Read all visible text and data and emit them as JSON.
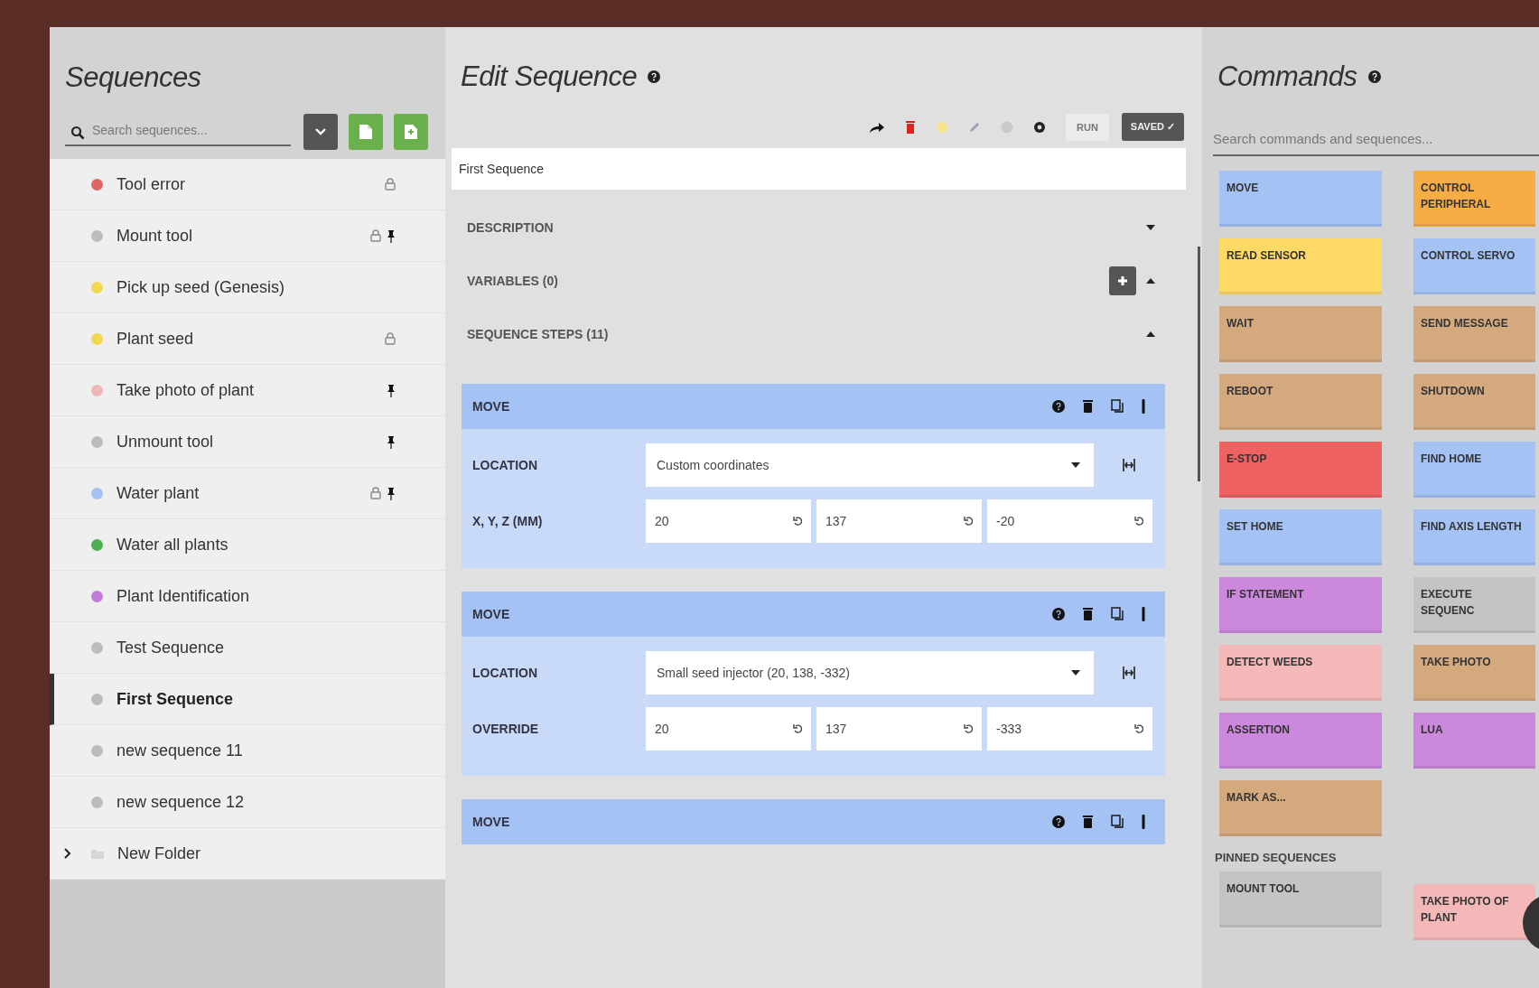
{
  "sequences_panel": {
    "title": "Sequences",
    "search": {
      "placeholder": "Search sequences..."
    },
    "items": [
      {
        "kind": "sequence",
        "name": "Tool error",
        "color": "#e06666",
        "selected": false,
        "locked": true,
        "pinned": false
      },
      {
        "kind": "sequence",
        "name": "Mount tool",
        "color": "#bcbcbc",
        "selected": false,
        "locked": true,
        "pinned": true
      },
      {
        "kind": "sequence",
        "name": "Pick up seed (Genesis)",
        "color": "#f1d84f",
        "selected": false,
        "locked": false,
        "pinned": false
      },
      {
        "kind": "sequence",
        "name": "Plant seed",
        "color": "#f1d84f",
        "selected": false,
        "locked": true,
        "pinned": false
      },
      {
        "kind": "sequence",
        "name": "Take photo of plant",
        "color": "#eeb8b8",
        "selected": false,
        "locked": false,
        "pinned": true
      },
      {
        "kind": "sequence",
        "name": "Unmount tool",
        "color": "#bcbcbc",
        "selected": false,
        "locked": false,
        "pinned": true
      },
      {
        "kind": "sequence",
        "name": "Water plant",
        "color": "#a4c2f4",
        "selected": false,
        "locked": true,
        "pinned": true
      },
      {
        "kind": "sequence",
        "name": "Water all plants",
        "color": "#4caf50",
        "selected": false,
        "locked": false,
        "pinned": false
      },
      {
        "kind": "sequence",
        "name": "Plant Identification",
        "color": "#c17cd8",
        "selected": false,
        "locked": false,
        "pinned": false
      },
      {
        "kind": "sequence",
        "name": "Test Sequence",
        "color": "#bcbcbc",
        "selected": false,
        "locked": false,
        "pinned": false
      },
      {
        "kind": "sequence",
        "name": "First Sequence",
        "color": "#bcbcbc",
        "selected": true,
        "locked": false,
        "pinned": false
      },
      {
        "kind": "sequence",
        "name": "new sequence 11",
        "color": "#bcbcbc",
        "selected": false,
        "locked": false,
        "pinned": false
      },
      {
        "kind": "sequence",
        "name": "new sequence 12",
        "color": "#bcbcbc",
        "selected": false,
        "locked": false,
        "pinned": false
      },
      {
        "kind": "folder",
        "name": "New Folder",
        "expanded": false
      }
    ]
  },
  "editor": {
    "title": "Edit Sequence",
    "toolbar": {
      "run_label": "RUN",
      "saved_label": "SAVED ✓"
    },
    "name": "First Sequence",
    "sections": [
      {
        "kind": "plain",
        "label": "DESCRIPTION",
        "expanded": false
      },
      {
        "kind": "variables",
        "label": "VARIABLES (0)",
        "expanded": true
      },
      {
        "kind": "plain",
        "label": "SEQUENCE STEPS (11)",
        "expanded": true
      }
    ],
    "steps": [
      {
        "title": "MOVE",
        "rows": [
          {
            "kind": "select",
            "label": "LOCATION",
            "value": "Custom coordinates"
          },
          {
            "kind": "xyz",
            "label": "X, Y, Z (MM)",
            "values": [
              "20",
              "137",
              "-20"
            ]
          }
        ]
      },
      {
        "title": "MOVE",
        "rows": [
          {
            "kind": "select",
            "label": "LOCATION",
            "value": "Small seed injector (20, 138, -332)"
          },
          {
            "kind": "xyz",
            "label": "OVERRIDE",
            "values": [
              "20",
              "137",
              "-333"
            ]
          }
        ]
      },
      {
        "title": "MOVE"
      }
    ]
  },
  "commands_panel": {
    "title": "Commands",
    "search": {
      "placeholder": "Search commands and sequences..."
    },
    "commands": [
      {
        "label": "MOVE",
        "color": "#a4c2f4"
      },
      {
        "label": "CONTROL PERIPHERAL",
        "color": "#f6ad45"
      },
      {
        "label": "READ SENSOR",
        "color": "#ffd966"
      },
      {
        "label": "CONTROL SERVO",
        "color": "#a4c2f4"
      },
      {
        "label": "WAIT",
        "color": "#d4a97e"
      },
      {
        "label": "SEND MESSAGE",
        "color": "#d4a97e"
      },
      {
        "label": "REBOOT",
        "color": "#d4a97e"
      },
      {
        "label": "SHUTDOWN",
        "color": "#d4a97e"
      },
      {
        "label": "E-STOP",
        "color": "#ee6262"
      },
      {
        "label": "FIND HOME",
        "color": "#a4c2f4"
      },
      {
        "label": "SET HOME",
        "color": "#a4c2f4"
      },
      {
        "label": "FIND AXIS LENGTH",
        "color": "#a4c2f4"
      },
      {
        "label": "IF STATEMENT",
        "color": "#cc88dd"
      },
      {
        "label": "EXECUTE SEQUENC",
        "color": "#c4c4c4"
      },
      {
        "label": "DETECT WEEDS",
        "color": "#f4b8b8"
      },
      {
        "label": "TAKE PHOTO",
        "color": "#d4a97e"
      },
      {
        "label": "ASSERTION",
        "color": "#cc88dd"
      },
      {
        "label": "LUA",
        "color": "#cc88dd"
      },
      {
        "label": "MARK AS...",
        "color": "#d4a97e"
      }
    ],
    "pinned_title": "PINNED SEQUENCES",
    "pinned": [
      {
        "label": "MOUNT TOOL",
        "color": "#c4c4c4"
      },
      {
        "label": "TAKE PHOTO OF PLANT",
        "color": "#f4b8b8"
      }
    ]
  }
}
